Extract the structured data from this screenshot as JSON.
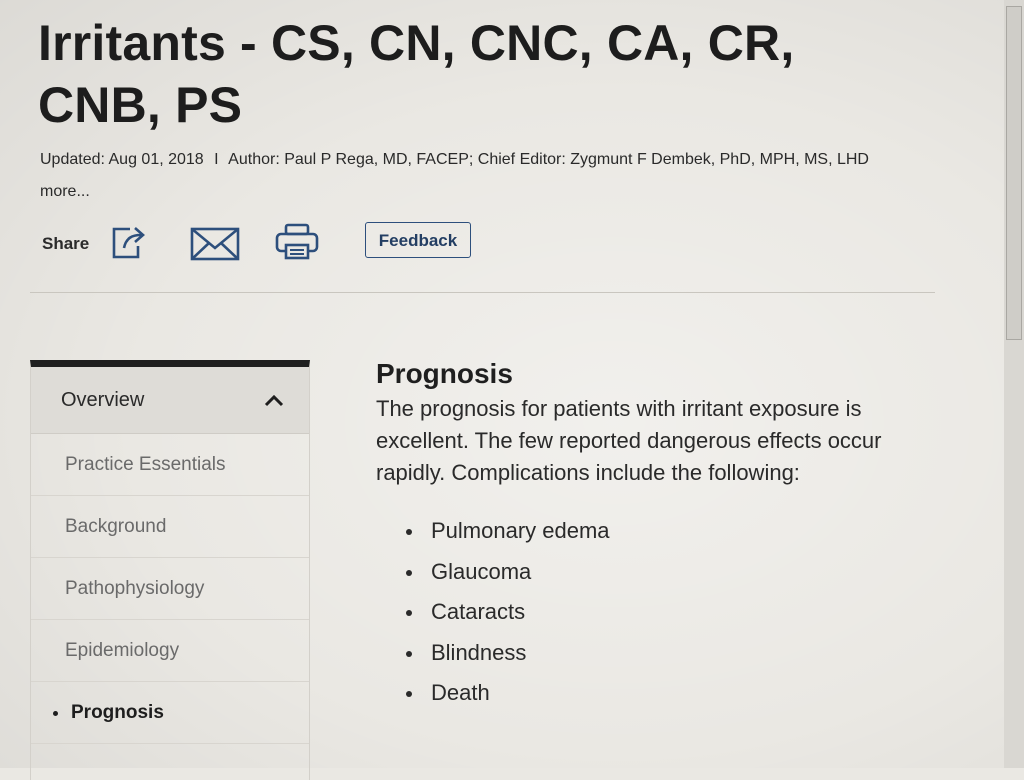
{
  "article": {
    "title": "Irritants - CS, CN, CNC, CA, CR, CNB, PS",
    "meta": {
      "updated": "Updated: Aug 01, 2018",
      "separator": "I",
      "authors": "Author: Paul P Rega, MD, FACEP; Chief Editor: Zygmunt F Dembek, PhD, MPH, MS, LHD",
      "more_link": "more..."
    }
  },
  "share_bar": {
    "label": "Share",
    "icons": [
      "share-icon",
      "email-icon",
      "print-icon"
    ],
    "feedback_button": "Feedback"
  },
  "sidebar": {
    "section_label": "Overview",
    "items": [
      {
        "label": "Practice Essentials",
        "active": false
      },
      {
        "label": "Background",
        "active": false
      },
      {
        "label": "Pathophysiology",
        "active": false
      },
      {
        "label": "Epidemiology",
        "active": false
      },
      {
        "label": "Prognosis",
        "active": true
      }
    ]
  },
  "content": {
    "heading": "Prognosis",
    "paragraph": "The prognosis for patients with irritant exposure is excellent. The few reported dangerous effects occur rapidly. Complications include the following:",
    "list": [
      "Pulmonary edema",
      "Glaucoma",
      "Cataracts",
      "Blindness",
      "Death"
    ]
  },
  "colors": {
    "feedback_border": "#2d4f7c",
    "icon_blue": "#2d4f7c",
    "sidebar_top_bar": "#1f1f1f"
  }
}
